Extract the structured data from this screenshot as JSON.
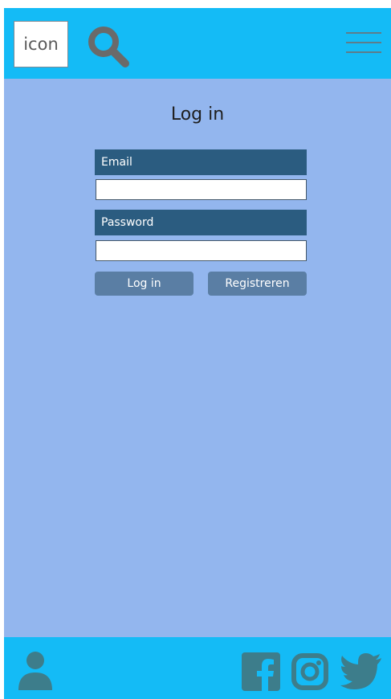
{
  "header": {
    "logo_text": "icon",
    "search_icon": "search-icon",
    "menu_icon": "hamburger-menu-icon"
  },
  "login": {
    "title": "Log in",
    "email_label": "Email",
    "email_value": "",
    "password_label": "Password",
    "password_value": "",
    "login_button": "Log in",
    "register_button": "Registreren"
  },
  "footer": {
    "icons": [
      "user-icon",
      "facebook-icon",
      "instagram-icon",
      "twitter-icon"
    ]
  },
  "colors": {
    "header_bg": "#14bbf6",
    "page_bg": "#93b6ee",
    "label_bg": "#2b5c80",
    "button_bg": "#5a7ea4",
    "icon_color": "#3d7d8b"
  }
}
